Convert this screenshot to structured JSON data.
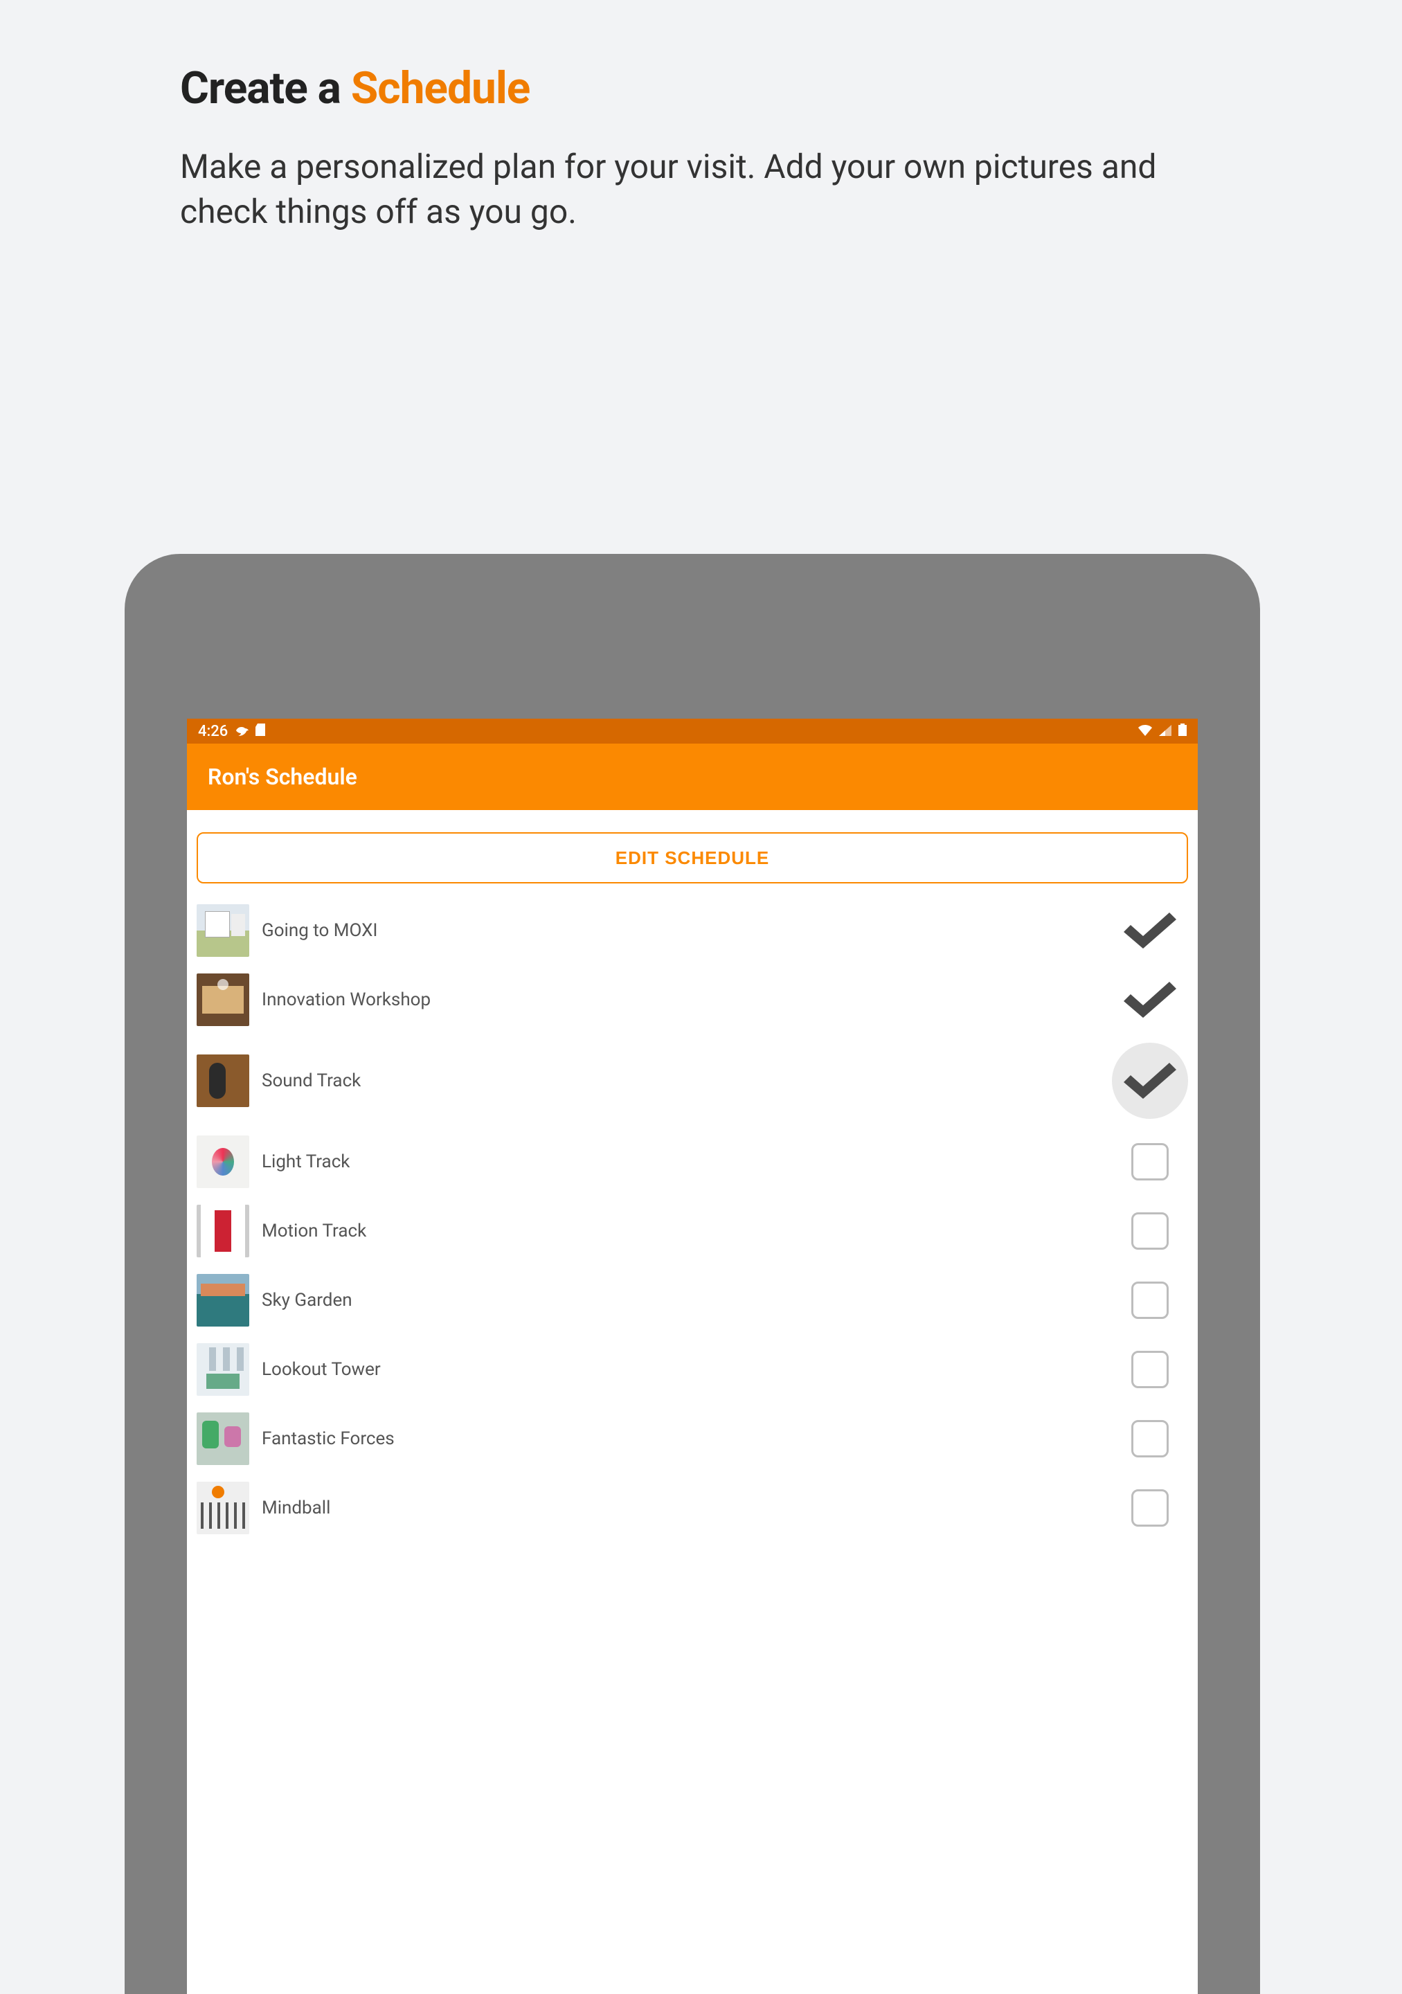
{
  "marketing": {
    "title_plain": "Create a ",
    "title_accent": "Schedule",
    "subtitle": "Make a personalized plan for your visit. Add your own pictures and check things off as you go."
  },
  "status_bar": {
    "time": "4:26"
  },
  "app_bar": {
    "title": "Ron's Schedule"
  },
  "buttons": {
    "edit_schedule": "EDIT SCHEDULE"
  },
  "schedule": [
    {
      "label": "Going to MOXI",
      "checked": true,
      "active": false
    },
    {
      "label": "Innovation Workshop",
      "checked": true,
      "active": false
    },
    {
      "label": "Sound Track",
      "checked": true,
      "active": true
    },
    {
      "label": "Light Track",
      "checked": false,
      "active": false
    },
    {
      "label": "Motion Track",
      "checked": false,
      "active": false
    },
    {
      "label": "Sky Garden",
      "checked": false,
      "active": false
    },
    {
      "label": "Lookout Tower",
      "checked": false,
      "active": false
    },
    {
      "label": "Fantastic Forces",
      "checked": false,
      "active": false
    },
    {
      "label": "Mindball",
      "checked": false,
      "active": false
    }
  ]
}
